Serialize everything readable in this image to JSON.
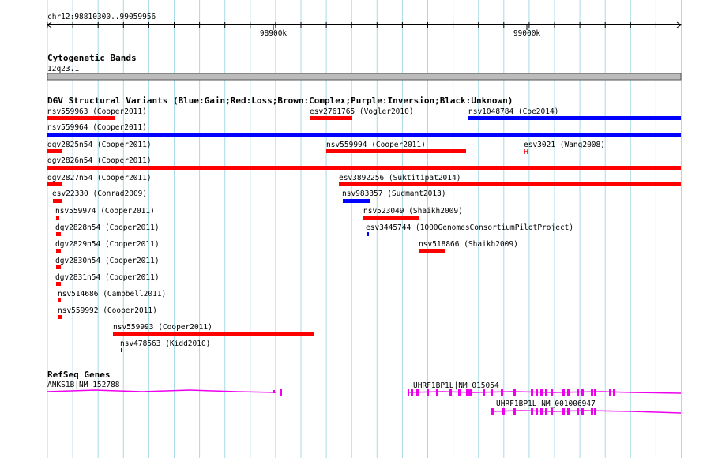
{
  "ruler": {
    "range_label": "chr12:98810300..99059956",
    "ticks": [
      {
        "label": "98900k"
      },
      {
        "label": "99000k"
      }
    ]
  },
  "cytoband": {
    "title": "Cytogenetic Bands",
    "band_label": "12q23.1"
  },
  "dgv": {
    "title": "DGV Structural Variants (Blue:Gain;Red:Loss;Brown:Complex;Purple:Inversion;Black:Unknown)",
    "colors": {
      "gain": "#0000ff",
      "loss": "#ff0000"
    },
    "features": [
      {
        "label": "nsv559963 (Cooper2011)",
        "type": "loss"
      },
      {
        "label": "esv2761765 (Vogler2010)",
        "type": "loss"
      },
      {
        "label": "nsv1048784 (Coe2014)",
        "type": "gain"
      },
      {
        "label": "nsv559964 (Cooper2011)",
        "type": "gain"
      },
      {
        "label": "dgv2825n54 (Cooper2011)",
        "type": "loss"
      },
      {
        "label": "nsv559994 (Cooper2011)",
        "type": "loss"
      },
      {
        "label": "esv3021 (Wang2008)",
        "type": "loss"
      },
      {
        "label": "dgv2826n54 (Cooper2011)",
        "type": "loss"
      },
      {
        "label": "dgv2827n54 (Cooper2011)",
        "type": "loss"
      },
      {
        "label": "esv3892256 (Suktitipat2014)",
        "type": "loss"
      },
      {
        "label": "esv22330 (Conrad2009)",
        "type": "loss"
      },
      {
        "label": "nsv983357 (Sudmant2013)",
        "type": "gain"
      },
      {
        "label": "nsv559974 (Cooper2011)",
        "type": "loss"
      },
      {
        "label": "nsv523049 (Shaikh2009)",
        "type": "loss"
      },
      {
        "label": "dgv2828n54 (Cooper2011)",
        "type": "loss"
      },
      {
        "label": "esv3445744 (1000GenomesConsortiumPilotProject)",
        "type": "gain"
      },
      {
        "label": "dgv2829n54 (Cooper2011)",
        "type": "loss"
      },
      {
        "label": "nsv518866 (Shaikh2009)",
        "type": "loss"
      },
      {
        "label": "dgv2830n54 (Cooper2011)",
        "type": "loss"
      },
      {
        "label": "dgv2831n54 (Cooper2011)",
        "type": "loss"
      },
      {
        "label": "nsv514686 (Campbell2011)",
        "type": "loss"
      },
      {
        "label": "nsv559992 (Cooper2011)",
        "type": "loss"
      },
      {
        "label": "nsv559993 (Cooper2011)",
        "type": "loss"
      },
      {
        "label": "nsv478563 (Kidd2010)",
        "type": "gain"
      }
    ]
  },
  "refseq": {
    "title": "RefSeq Genes",
    "color": "#ee00ee",
    "genes": [
      {
        "label": "ANKS1B|NM_152788"
      },
      {
        "label": "UHRF1BP1L|NM_015054"
      },
      {
        "label": "UHRF1BP1L|NM_001006947"
      }
    ]
  }
}
